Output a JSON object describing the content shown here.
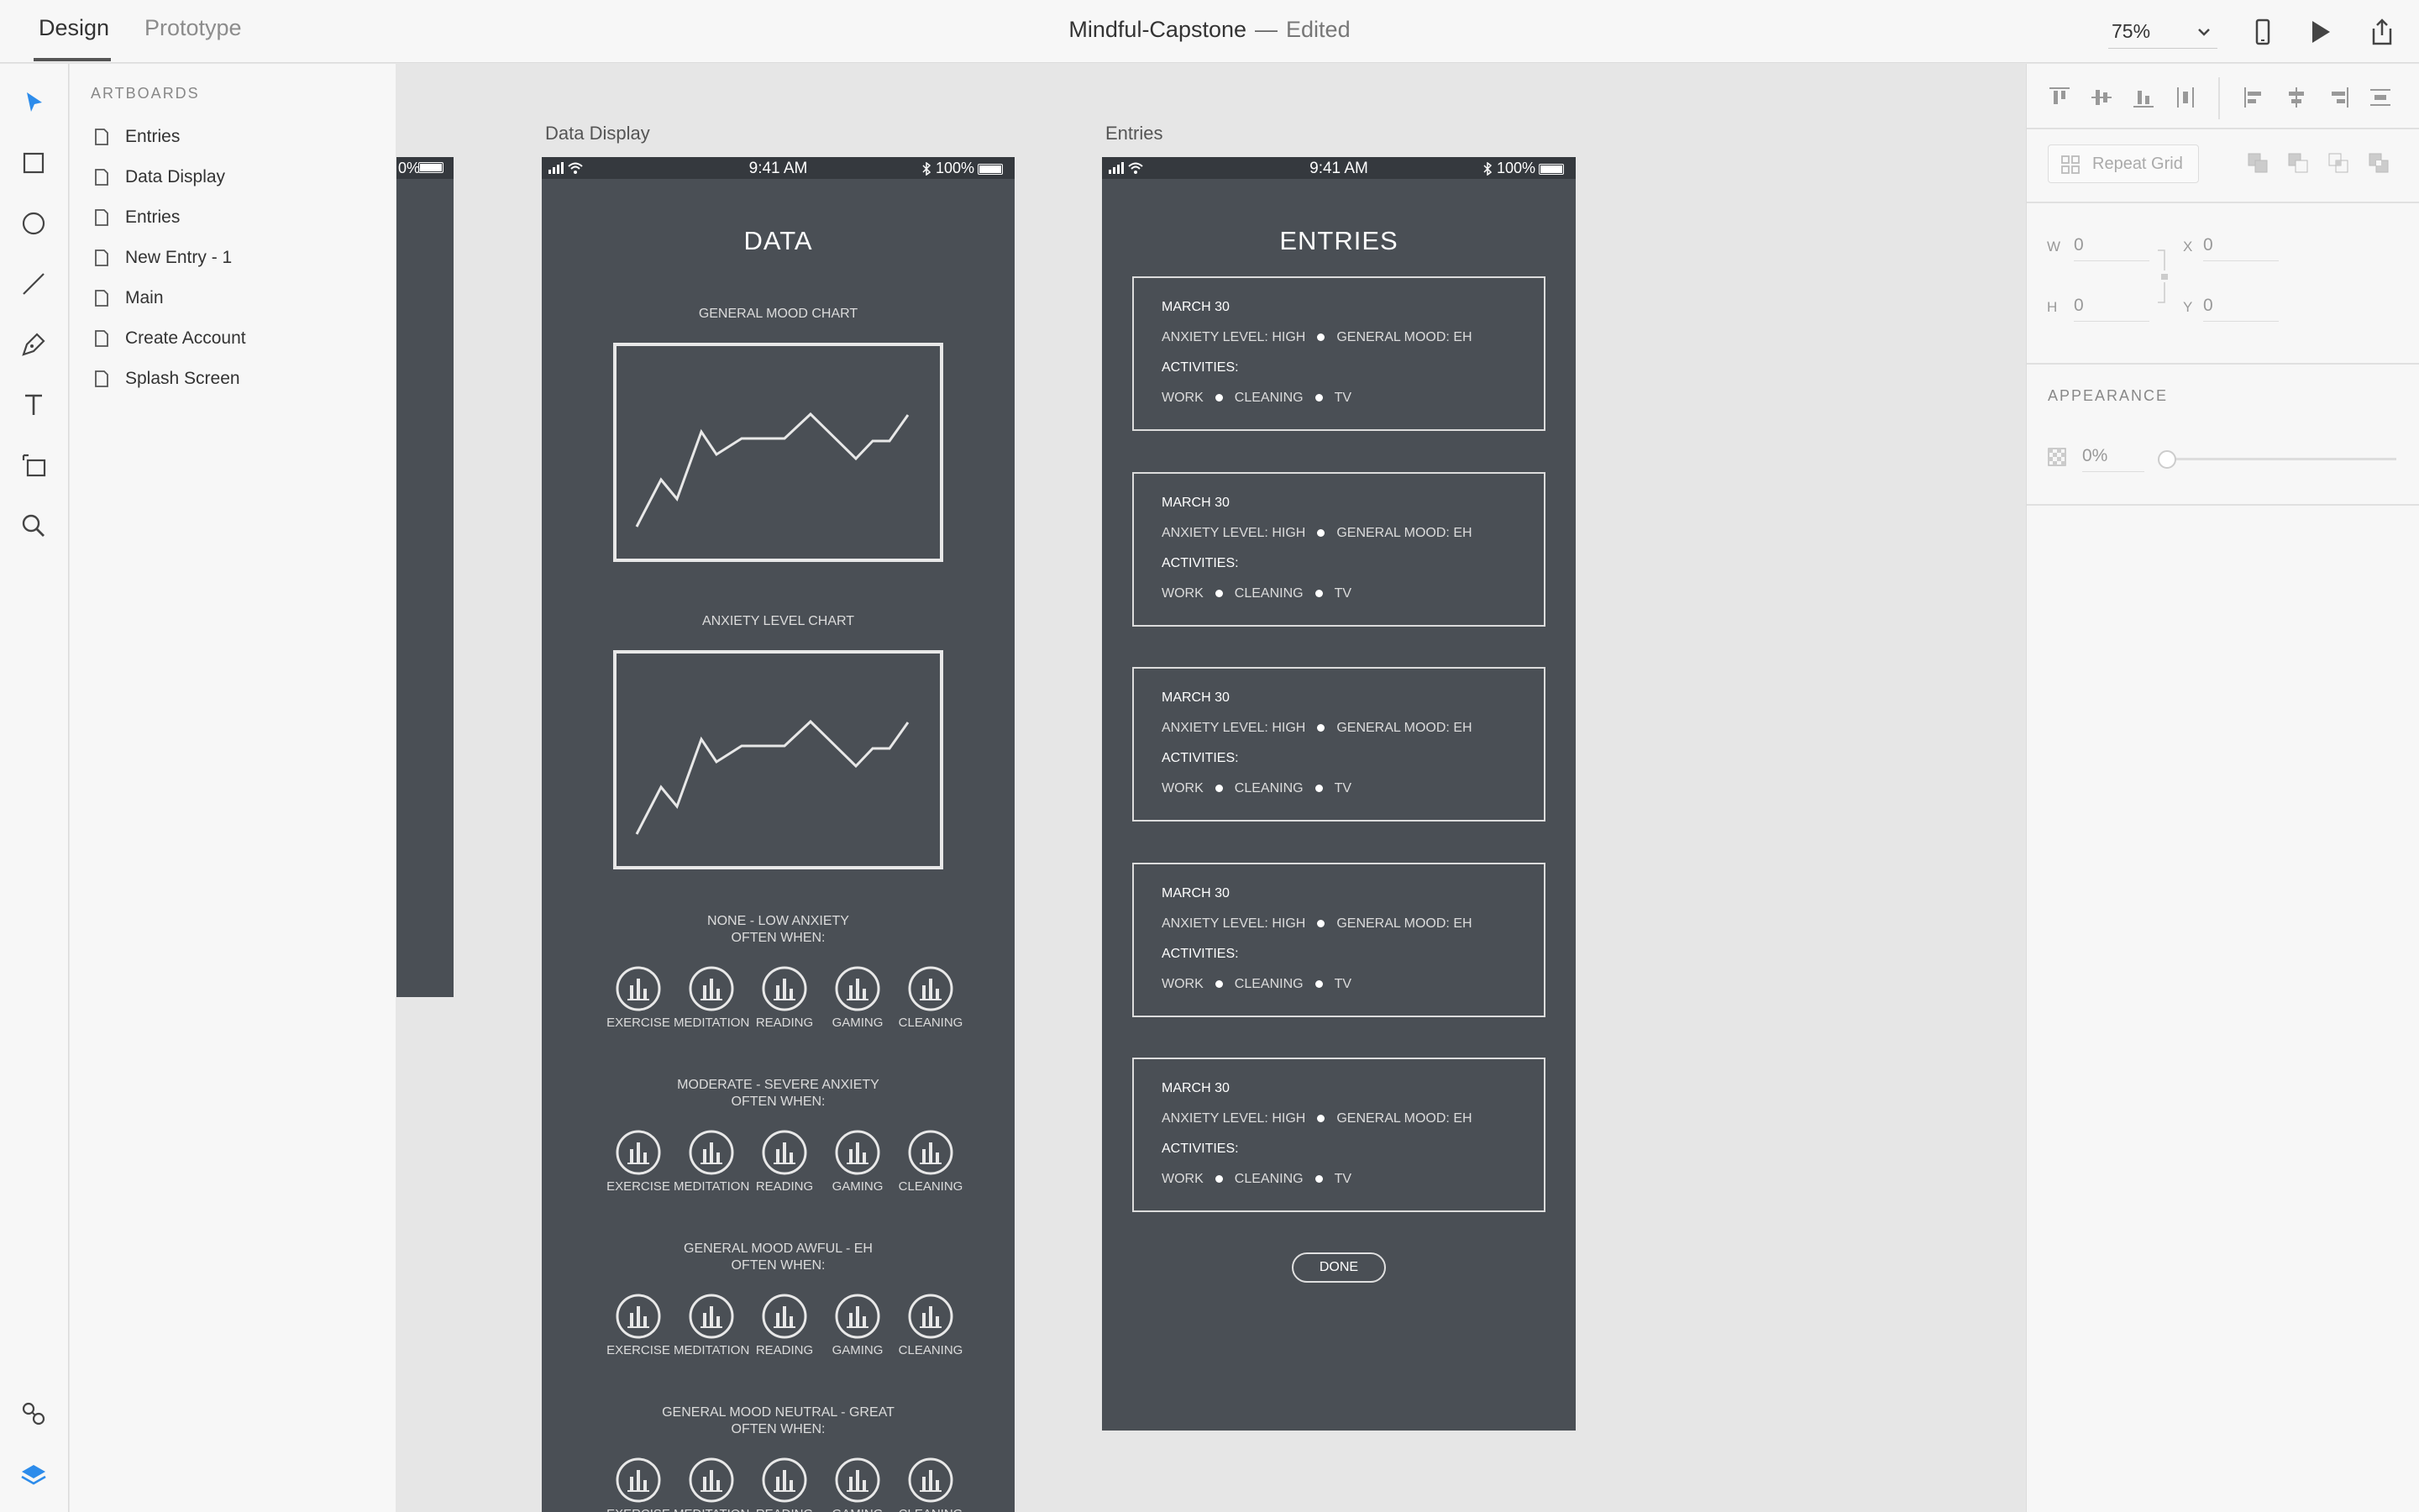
{
  "topbar": {
    "tabs": [
      "Design",
      "Prototype"
    ],
    "document_name": "Mindful-Capstone",
    "separator": "—",
    "document_status": "Edited",
    "zoom": "75%"
  },
  "toolbar": {
    "tools": [
      "select-icon",
      "rectangle-icon",
      "ellipse-icon",
      "line-icon",
      "pen-icon",
      "text-icon",
      "artboard-icon",
      "zoom-icon"
    ],
    "bottom": [
      "assets-icon",
      "layers-icon"
    ]
  },
  "layers_panel": {
    "heading": "ARTBOARDS",
    "items": [
      "Entries",
      "Data Display",
      "Entries",
      "New Entry - 1",
      "Main",
      "Create Account",
      "Splash Screen"
    ]
  },
  "properties": {
    "repeat_grid": "Repeat Grid",
    "w_label": "W",
    "w_value": "0",
    "h_label": "H",
    "h_value": "0",
    "x_label": "X",
    "x_value": "0",
    "y_label": "Y",
    "y_value": "0",
    "appearance_label": "APPEARANCE",
    "opacity": "0%"
  },
  "partial_artboard": {
    "status_text": "0%"
  },
  "status_bar": {
    "time": "9:41 AM",
    "battery": "100%"
  },
  "data_display": {
    "title": "Data Display",
    "heading": "DATA",
    "charts": [
      {
        "label": "GENERAL MOOD CHART"
      },
      {
        "label": "ANXIETY LEVEL CHART"
      }
    ],
    "sections": [
      {
        "title": "NONE - LOW ANXIETY",
        "subtitle": "OFTEN WHEN:"
      },
      {
        "title": "MODERATE - SEVERE ANXIETY",
        "subtitle": "OFTEN WHEN:"
      },
      {
        "title": "GENERAL MOOD AWFUL - EH",
        "subtitle": "OFTEN WHEN:"
      },
      {
        "title": "GENERAL MOOD NEUTRAL - GREAT",
        "subtitle": "OFTEN WHEN:"
      }
    ],
    "activities": [
      "EXERCISE",
      "MEDITATION",
      "READING",
      "GAMING",
      "CLEANING"
    ]
  },
  "entries_screen": {
    "title": "Entries",
    "heading": "ENTRIES",
    "entries": [
      {
        "date": "MARCH 30",
        "anxiety": "ANXIETY LEVEL: HIGH",
        "mood": "GENERAL MOOD: EH",
        "activities_label": "ACTIVITIES:",
        "activities": [
          "WORK",
          "CLEANING",
          "TV"
        ]
      },
      {
        "date": "MARCH 30",
        "anxiety": "ANXIETY LEVEL: HIGH",
        "mood": "GENERAL MOOD: EH",
        "activities_label": "ACTIVITIES:",
        "activities": [
          "WORK",
          "CLEANING",
          "TV"
        ]
      },
      {
        "date": "MARCH 30",
        "anxiety": "ANXIETY LEVEL: HIGH",
        "mood": "GENERAL MOOD: EH",
        "activities_label": "ACTIVITIES:",
        "activities": [
          "WORK",
          "CLEANING",
          "TV"
        ]
      },
      {
        "date": "MARCH 30",
        "anxiety": "ANXIETY LEVEL: HIGH",
        "mood": "GENERAL MOOD: EH",
        "activities_label": "ACTIVITIES:",
        "activities": [
          "WORK",
          "CLEANING",
          "TV"
        ]
      },
      {
        "date": "MARCH 30",
        "anxiety": "ANXIETY LEVEL: HIGH",
        "mood": "GENERAL MOOD: EH",
        "activities_label": "ACTIVITIES:",
        "activities": [
          "WORK",
          "CLEANING",
          "TV"
        ]
      }
    ],
    "done_button": "DONE"
  },
  "colors": {
    "accent": "#2d8ceb",
    "artboard_bg": "#4a4f55",
    "statusbar_bg": "#35393e",
    "canvas_bg": "#e6e6e6"
  }
}
